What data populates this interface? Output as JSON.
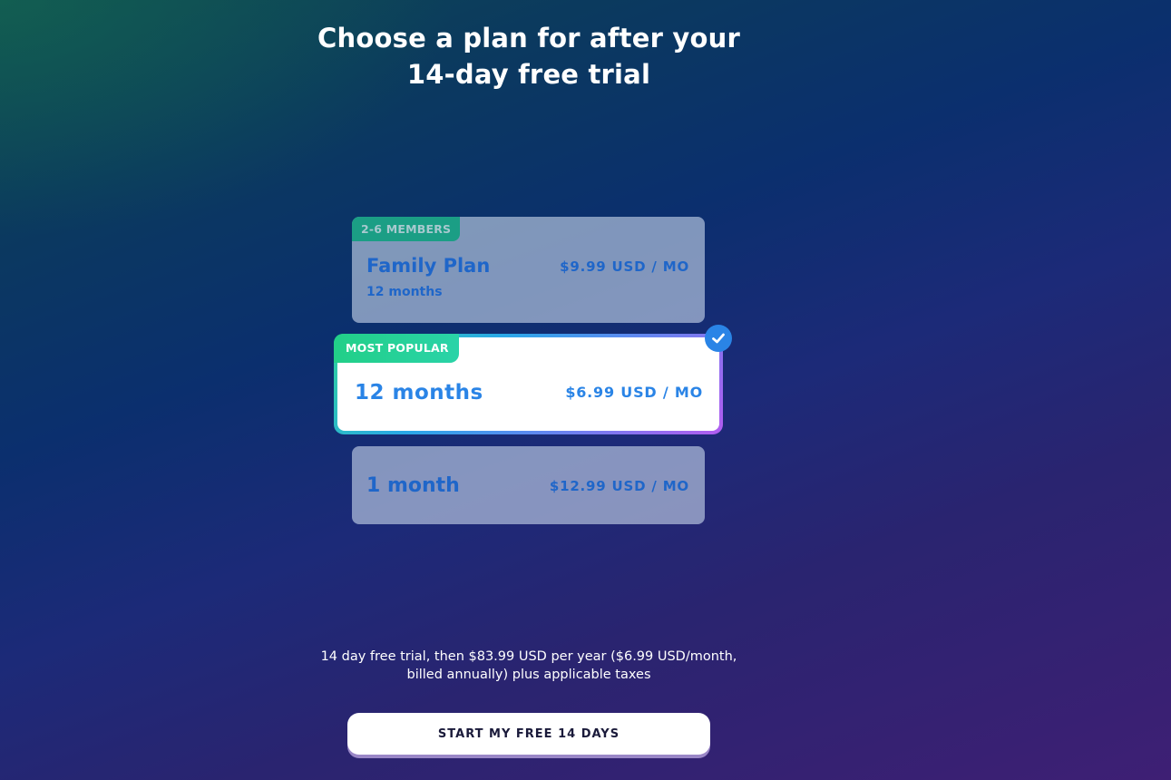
{
  "header": {
    "title_line1": "Choose a plan for after your",
    "title_line2": "14-day free trial"
  },
  "plans": [
    {
      "badge": "2-6 MEMBERS",
      "name": "Family Plan",
      "sub": "12 months",
      "price": "$9.99 USD / MO",
      "selected": false
    },
    {
      "badge": "MOST POPULAR",
      "name": "12 months",
      "price": "$6.99 USD / MO",
      "selected": true
    },
    {
      "name": "1 month",
      "price": "$12.99 USD / MO",
      "selected": false
    }
  ],
  "selected_icon": "check-icon",
  "footer": {
    "fineprint_line1": "14 day free trial, then $83.99 USD per year ($6.99 USD/month,",
    "fineprint_line2": "billed annually) plus applicable taxes",
    "cta_label": "START MY FREE 14 DAYS"
  },
  "colors": {
    "accent": "#2a84e6",
    "badge_popular": "#22cf88",
    "badge_family": "#1b9e85",
    "plan_text": "#1f66c9"
  }
}
